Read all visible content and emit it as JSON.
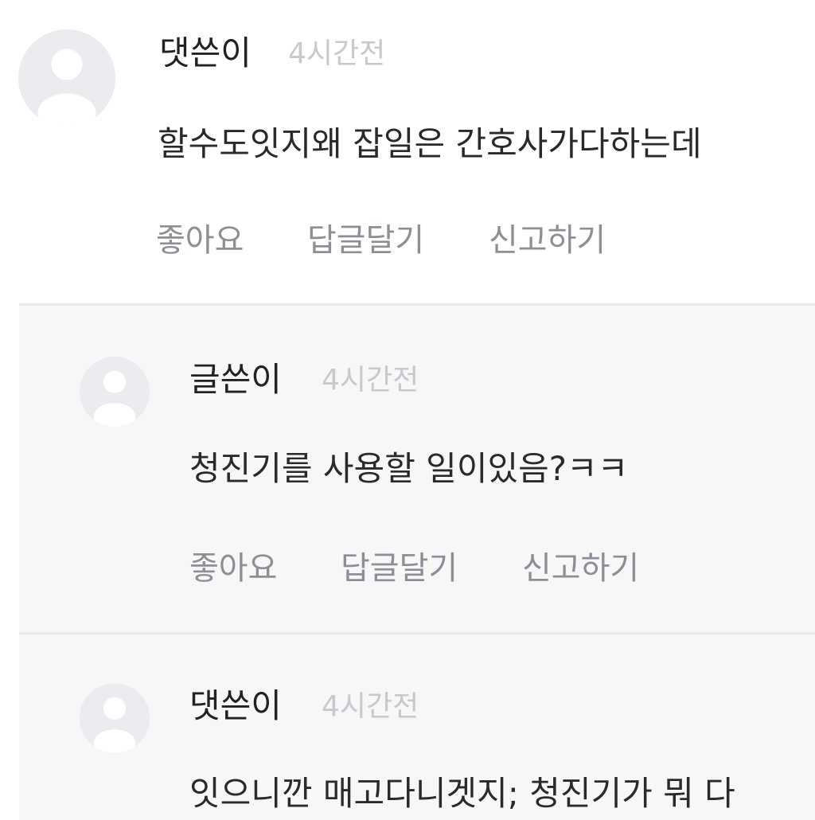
{
  "comments": [
    {
      "author": "댓쓴이",
      "time": "4시간전",
      "text": "할수도잇지왜 잡일은 간호사가다하는데",
      "actions": {
        "like": "좋아요",
        "reply": "답글달기",
        "report": "신고하기"
      }
    },
    {
      "author": "글쓴이",
      "time": "4시간전",
      "text": "청진기를 사용할 일이있음?ㅋㅋ",
      "actions": {
        "like": "좋아요",
        "reply": "답글달기",
        "report": "신고하기"
      }
    },
    {
      "author": "댓쓴이",
      "time": "4시간전",
      "text": "잇으니깐 매고다니겟지;  청진기가 뭐 다"
    }
  ],
  "colors": {
    "avatar_bg": "#ebebf0",
    "avatar_fg": "#ffffff",
    "reply_bg": "#f7f7f8",
    "author": "#222222",
    "time": "#c8c8cf",
    "action": "#8e8e96"
  },
  "icons": {
    "avatar": "user-silhouette-icon"
  }
}
